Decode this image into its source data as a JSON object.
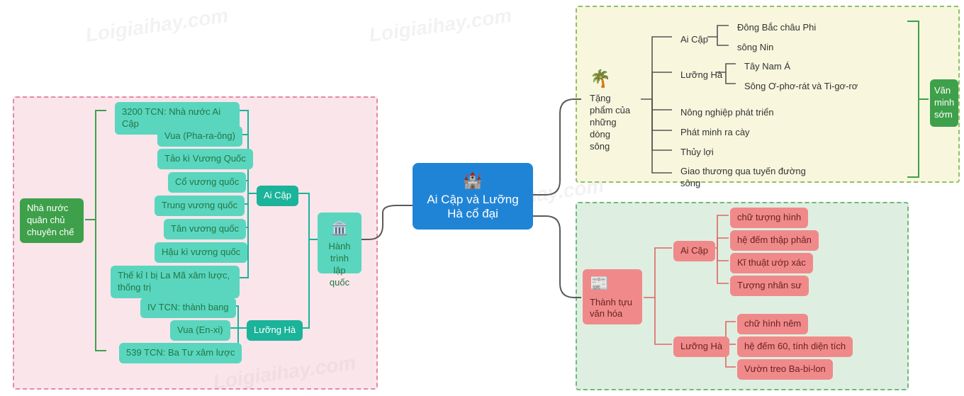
{
  "center": {
    "icon": "🏰",
    "title": "Ai Cập và Lưỡng Hà cổ đại"
  },
  "watermark": "Loigiaihay.com",
  "left": {
    "branch_label": "Hành trình lập quốc",
    "branch_icon": "🏛️",
    "side_label": "Nhà nước quân chủ chuyên chế",
    "aicap_label": "Ai Cập",
    "aicap_items": [
      "3200 TCN: Nhà nước Ai Cập",
      "Vua (Pha-ra-ông)",
      "Tảo kì Vương Quốc",
      "Cổ vương quốc",
      "Trung vương quốc",
      "Tân vương quốc",
      "Hậu kì vương quốc",
      "Thế kỉ I bị La Mã xâm lược, thống trị"
    ],
    "luongha_label": "Lưỡng Hà",
    "luongha_items": [
      "IV TCN: thành bang",
      "Vua (En-xi)",
      "539 TCN: Ba Tư xâm lược"
    ]
  },
  "top_right": {
    "branch_label": "Tặng phẩm của những dòng sông",
    "branch_icon": "🌴",
    "side_label": "Văn minh sớm",
    "aicap_label": "Ai Cập",
    "aicap_items": [
      "Đông Bắc châu Phi",
      "sông Nin"
    ],
    "luongha_label": "Lưỡng Hà",
    "luongha_items": [
      "Tây Nam Á",
      "Sông Ơ-phơ-rát và Ti-gơ-rơ"
    ],
    "extra_items": [
      "Nông nghiệp phát triển",
      "Phát minh ra cày",
      "Thủy lợi",
      "Giao thương qua tuyến đường sông"
    ]
  },
  "bottom_right": {
    "branch_label": "Thành tựu văn hóa",
    "branch_icon": "📰",
    "aicap_label": "Ai Cập",
    "aicap_items": [
      "chữ tượng hình",
      "hệ đếm thập phân",
      "Kĩ thuật ướp xác",
      "Tượng nhân sư"
    ],
    "luongha_label": "Lưỡng Hà",
    "luongha_items": [
      "chữ hình nêm",
      "hệ đếm 60, tính diện tích",
      "Vườn treo Ba-bi-lon"
    ]
  }
}
